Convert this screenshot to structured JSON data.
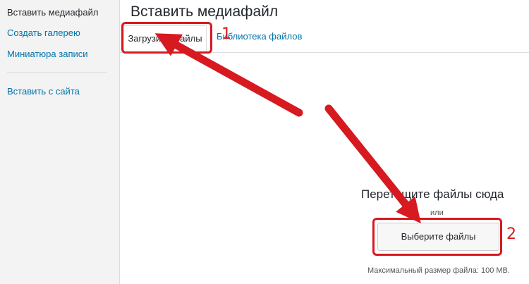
{
  "sidebar": {
    "items": [
      {
        "label": "Вставить медиафайл",
        "active": true
      },
      {
        "label": "Создать галерею",
        "active": false
      },
      {
        "label": "Миниатюра записи",
        "active": false
      },
      {
        "label": "Вставить с сайта",
        "active": false
      }
    ]
  },
  "main": {
    "title": "Вставить медиафайл",
    "tabs": [
      {
        "label": "Загрузить файлы",
        "active": true
      },
      {
        "label": "Библиотека файлов",
        "active": false
      }
    ],
    "upload": {
      "drop_text": "Перетащите файлы сюда",
      "or_text": "или",
      "select_button": "Выберите файлы",
      "max_size": "Максимальный размер файла: 100 MB."
    }
  },
  "annotations": {
    "marker_1": "1",
    "marker_2": "2",
    "color": "#d71920"
  }
}
